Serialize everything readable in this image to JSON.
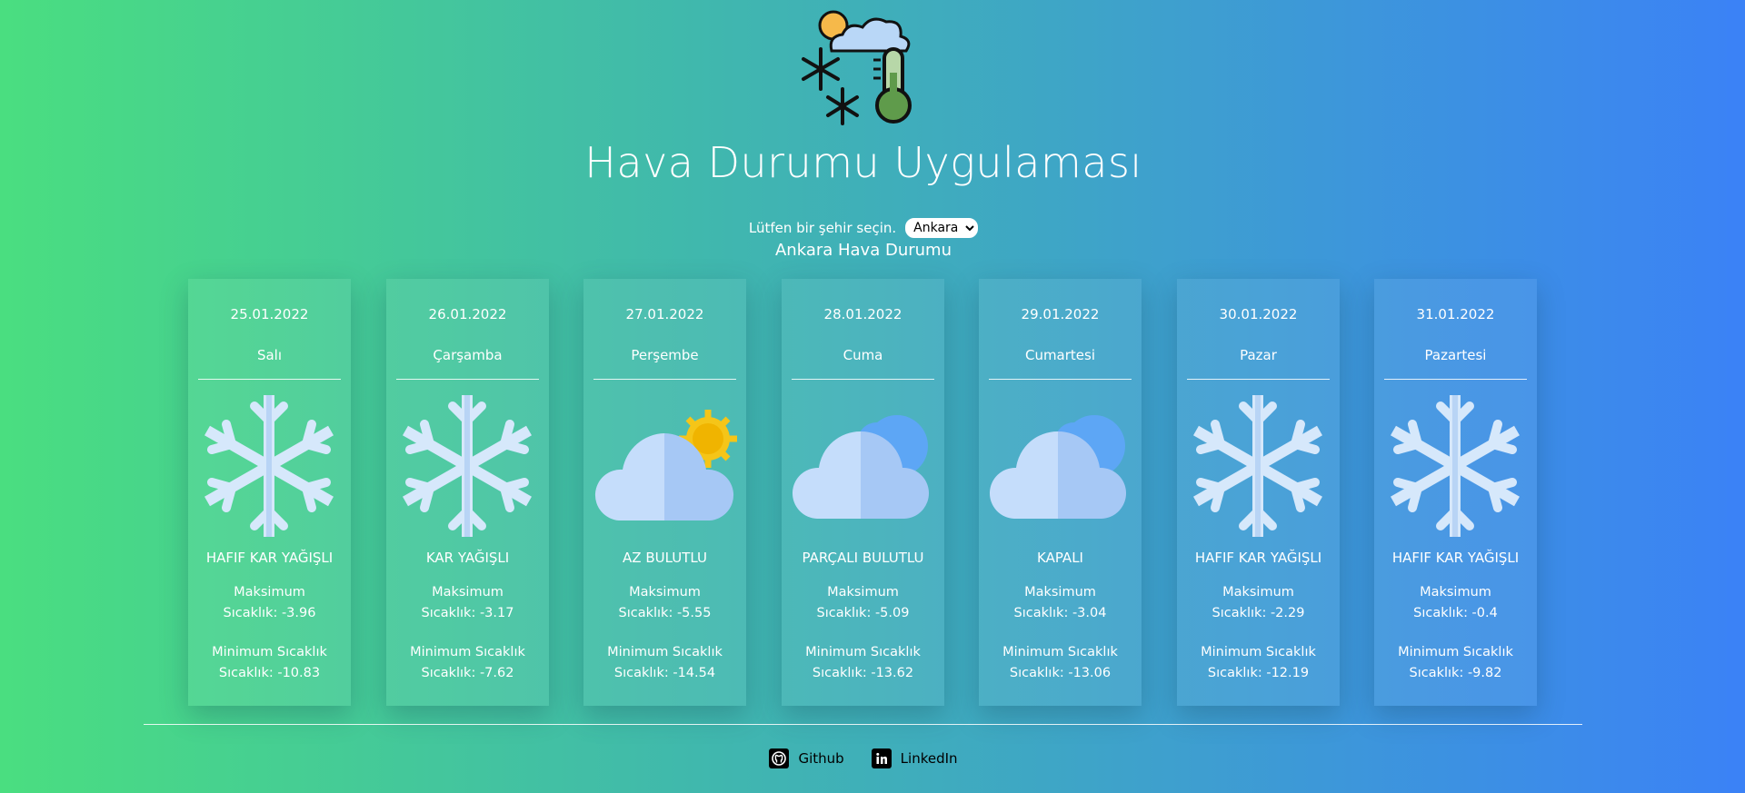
{
  "app": {
    "title": "Hava Durumu Uygulaması",
    "select_label": "Lütfen bir şehir seçin.",
    "selected_city": "Ankara",
    "subtitle": "Ankara Hava Durumu"
  },
  "days": [
    {
      "date": "25.01.2022",
      "day": "Salı",
      "icon": "snowflake-icon",
      "desc": "HAFIF KAR YAĞIŞLI",
      "max_l1": "Maksimum",
      "max_l2": "Sıcaklık: -3.96",
      "min_l1": "Minimum Sıcaklık",
      "min_l2": "Sıcaklık: -10.83"
    },
    {
      "date": "26.01.2022",
      "day": "Çarşamba",
      "icon": "snowflake-icon",
      "desc": "KAR YAĞIŞLI",
      "max_l1": "Maksimum",
      "max_l2": "Sıcaklık: -3.17",
      "min_l1": "Minimum Sıcaklık",
      "min_l2": "Sıcaklık: -7.62"
    },
    {
      "date": "27.01.2022",
      "day": "Perşembe",
      "icon": "cloud-sun-icon",
      "desc": "AZ BULUTLU",
      "max_l1": "Maksimum",
      "max_l2": "Sıcaklık: -5.55",
      "min_l1": "Minimum Sıcaklık",
      "min_l2": "Sıcaklık: -14.54"
    },
    {
      "date": "28.01.2022",
      "day": "Cuma",
      "icon": "cloud-icon",
      "desc": "PARÇALI BULUTLU",
      "max_l1": "Maksimum",
      "max_l2": "Sıcaklık: -5.09",
      "min_l1": "Minimum Sıcaklık",
      "min_l2": "Sıcaklık: -13.62"
    },
    {
      "date": "29.01.2022",
      "day": "Cumartesi",
      "icon": "cloud-icon",
      "desc": "KAPALI",
      "max_l1": "Maksimum",
      "max_l2": "Sıcaklık: -3.04",
      "min_l1": "Minimum Sıcaklık",
      "min_l2": "Sıcaklık: -13.06"
    },
    {
      "date": "30.01.2022",
      "day": "Pazar",
      "icon": "snowflake-icon",
      "desc": "HAFIF KAR YAĞIŞLI",
      "max_l1": "Maksimum",
      "max_l2": "Sıcaklık: -2.29",
      "min_l1": "Minimum Sıcaklık",
      "min_l2": "Sıcaklık: -12.19"
    },
    {
      "date": "31.01.2022",
      "day": "Pazartesi",
      "icon": "snowflake-icon",
      "desc": "HAFIF KAR YAĞIŞLI",
      "max_l1": "Maksimum",
      "max_l2": "Sıcaklık: -0.4",
      "min_l1": "Minimum Sıcaklık",
      "min_l2": "Sıcaklık: -9.82"
    }
  ],
  "footer": {
    "github": "Github",
    "linkedin": "LinkedIn"
  },
  "colors": {
    "gradient_start": "#4ade80",
    "gradient_end": "#3b82f6",
    "text": "#ffffff"
  }
}
